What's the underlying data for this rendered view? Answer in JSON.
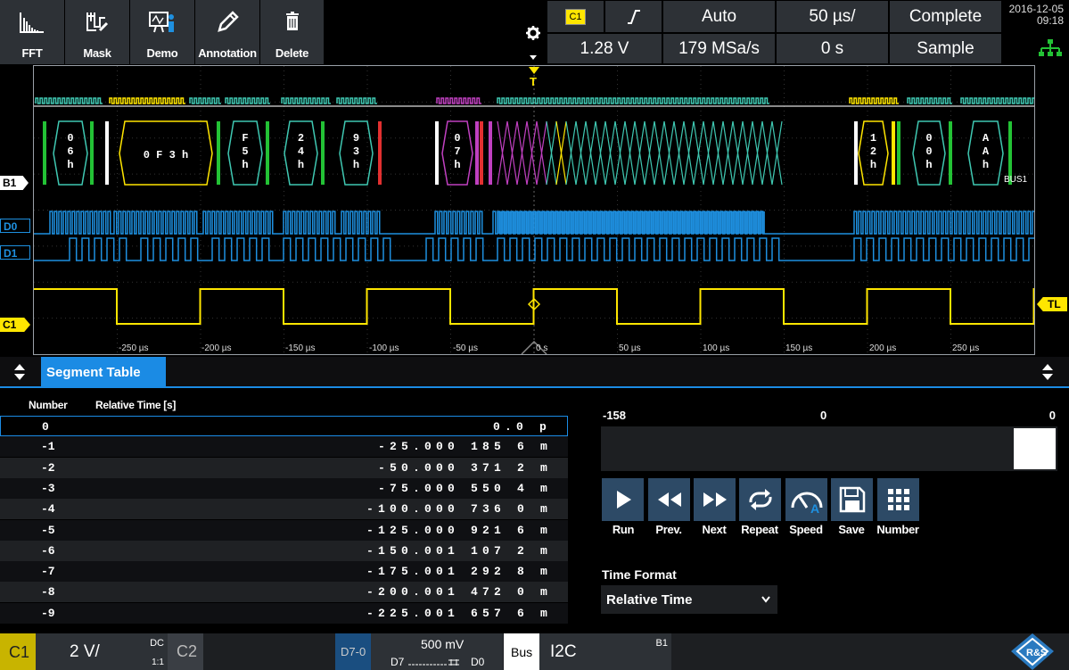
{
  "toolbar": {
    "fft": "FFT",
    "mask": "Mask",
    "demo": "Demo",
    "annotation": "Annotation",
    "delete": "Delete"
  },
  "trigger": {
    "source": "C1",
    "mode": "Auto",
    "time_base": "50 µs/",
    "acq_state": "Complete",
    "level": "1.28 V",
    "sample_rate": "179 MSa/s",
    "position": "0 s",
    "acq_mode": "Sample"
  },
  "datetime": {
    "date": "2016-12-05",
    "time": "09:18"
  },
  "scope": {
    "trigger_marker": "T",
    "bus_label": "B1",
    "d0_label": "D0",
    "d1_label": "D1",
    "c1_label": "C1",
    "trigger_level_label": "TL",
    "bus_tag": "BUS1",
    "x_ticks": [
      "-250 µs",
      "-200 µs",
      "-150 µs",
      "-100 µs",
      "-50 µs",
      "0 s",
      "50 µs",
      "100 µs",
      "150 µs",
      "200 µs",
      "250 µs"
    ],
    "decodes": [
      {
        "chars": [
          "0",
          "6",
          "h"
        ]
      },
      {
        "chars": [
          "0 F 3 h"
        ]
      },
      {
        "chars": [
          "F",
          "5",
          "h"
        ]
      },
      {
        "chars": [
          "2",
          "4",
          "h"
        ]
      },
      {
        "chars": [
          "9",
          "3",
          "h"
        ]
      },
      {
        "chars": [
          "0",
          "7",
          "h"
        ]
      },
      {
        "chars": [
          "1",
          "2",
          "h"
        ]
      },
      {
        "chars": [
          "0",
          "0",
          "h"
        ]
      },
      {
        "chars": [
          "A",
          "A",
          "h"
        ]
      }
    ],
    "colors": {
      "bus": "#3fc8b2",
      "digital": "#1e90e0",
      "analog": "#ffe600",
      "ack": "#23c235",
      "stop": "#e23030"
    }
  },
  "segment_table": {
    "tab_label": "Segment Table",
    "col_number": "Number",
    "col_time": "Relative Time [s]",
    "rows": [
      {
        "num": "0",
        "time": "0.0 p"
      },
      {
        "num": "-1",
        "time": "-25.000 185 6 m"
      },
      {
        "num": "-2",
        "time": "-50.000 371 2 m"
      },
      {
        "num": "-3",
        "time": "-75.000 550 4 m"
      },
      {
        "num": "-4",
        "time": "-100.000 736 0 m"
      },
      {
        "num": "-5",
        "time": "-125.000 921 6 m"
      },
      {
        "num": "-6",
        "time": "-150.001 107 2 m"
      },
      {
        "num": "-7",
        "time": "-175.001 292 8 m"
      },
      {
        "num": "-8",
        "time": "-200.001 472 0 m"
      },
      {
        "num": "-9",
        "time": "-225.001 657 6 m"
      }
    ]
  },
  "playback": {
    "range_start": "-158",
    "range_mid": "0",
    "range_end": "0",
    "buttons": [
      "Run",
      "Prev.",
      "Next",
      "Repeat",
      "Speed",
      "Save",
      "Number"
    ],
    "time_format_label": "Time Format",
    "time_format_value": "Relative Time"
  },
  "bottom": {
    "c1": "C1",
    "c1_scale": "2 V/",
    "c1_coupling": "DC",
    "c1_ratio": "1:1",
    "c2": "C2",
    "logic": "D7-0",
    "logic_threshold": "500 mV",
    "logic_d7": "D7",
    "logic_d0": "D0",
    "bus": "Bus",
    "protocol": "I2C",
    "bus_id": "B1"
  }
}
